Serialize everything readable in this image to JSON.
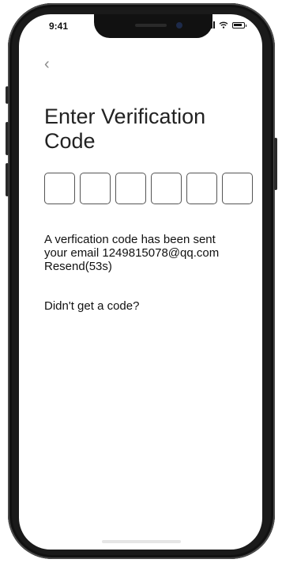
{
  "status_bar": {
    "time": "9:41"
  },
  "header": {
    "back_icon": "chevron-left-icon",
    "back_glyph": "‹"
  },
  "page": {
    "title": "Enter Verification Code"
  },
  "code_input": {
    "length": 6,
    "digits": [
      "",
      "",
      "",
      "",
      "",
      ""
    ]
  },
  "message": {
    "line1": "A verfication code has been sent",
    "line2": "your email 1249815078@qq.com",
    "resend_label": "Resend(53s)"
  },
  "help": {
    "no_code_label": "Didn't get a code?"
  },
  "colors": {
    "text": "#111111",
    "back_icon": "#8a8a8a",
    "box_border": "#555555"
  }
}
